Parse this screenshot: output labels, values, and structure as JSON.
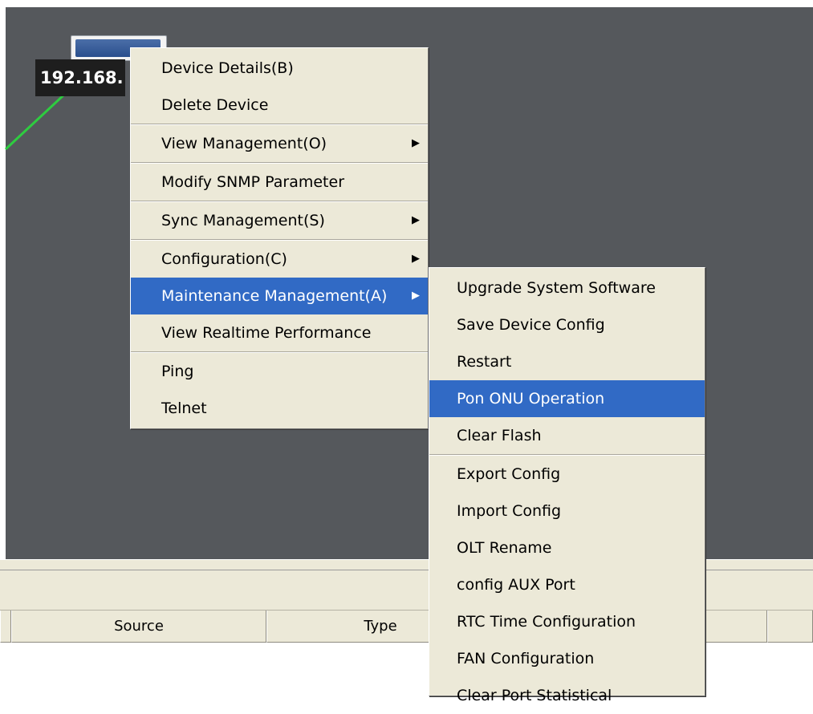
{
  "device": {
    "ip_label": "192.168."
  },
  "table": {
    "headers": [
      "",
      "Source",
      "Type",
      "",
      ""
    ]
  },
  "context_menu": {
    "items": [
      {
        "label": "Device Details(B)",
        "has_submenu": false
      },
      {
        "label": "Delete Device",
        "has_submenu": false
      },
      {
        "label": "View Management(O)",
        "has_submenu": true
      },
      {
        "label": "Modify SNMP Parameter",
        "has_submenu": false
      },
      {
        "label": "Sync Management(S)",
        "has_submenu": true
      },
      {
        "label": "Configuration(C)",
        "has_submenu": true
      },
      {
        "label": "Maintenance Management(A)",
        "has_submenu": true,
        "highlighted": true
      },
      {
        "label": "View Realtime Performance",
        "has_submenu": false
      },
      {
        "label": "Ping",
        "has_submenu": false
      },
      {
        "label": "Telnet",
        "has_submenu": false
      }
    ]
  },
  "submenu": {
    "items": [
      {
        "label": "Upgrade System Software"
      },
      {
        "label": "Save Device Config"
      },
      {
        "label": "Restart"
      },
      {
        "label": "Pon ONU Operation",
        "highlighted": true
      },
      {
        "label": "Clear Flash"
      },
      {
        "label": "Export Config"
      },
      {
        "label": "Import Config"
      },
      {
        "label": "OLT Rename"
      },
      {
        "label": "config AUX Port"
      },
      {
        "label": "RTC Time Configuration"
      },
      {
        "label": "FAN Configuration"
      },
      {
        "label": "Clear Port Statistical"
      }
    ]
  },
  "colors": {
    "canvas": "#55585c",
    "highlight": "#316ac5",
    "menu_bg": "#ece9d8",
    "link": "#2ecc40"
  },
  "icons": {
    "submenu_arrow": "triangle-right-icon"
  }
}
